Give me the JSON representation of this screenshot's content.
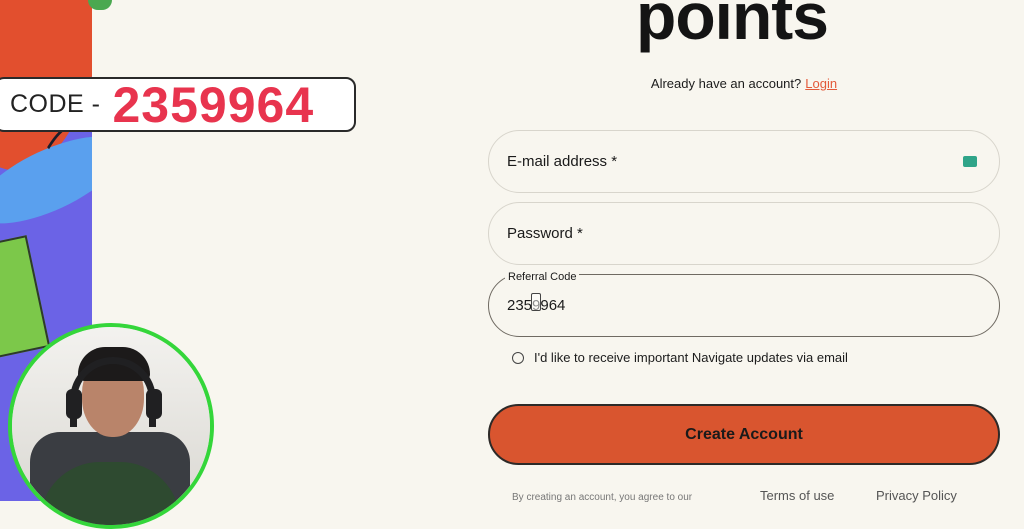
{
  "code_overlay": {
    "label": "CODE -",
    "value": "2359964"
  },
  "brand": {
    "title": "points"
  },
  "auth": {
    "question": "Already have an account?",
    "login_link": "Login"
  },
  "form": {
    "email_label": "E-mail address *",
    "password_label": "Password *",
    "referral_label": "Referral Code",
    "referral_value": "2359964",
    "updates_checkbox_label": "I'd like to receive important Navigate updates via email",
    "submit_label": "Create Account"
  },
  "footer": {
    "fine_print": "By creating an account, you agree to our",
    "terms_link": "Terms of use",
    "privacy_link": "Privacy Policy"
  },
  "colors": {
    "accent": "#d9552f",
    "link": "#e35a3a",
    "code": "#e8344e",
    "webcam_ring": "#34d63a"
  }
}
